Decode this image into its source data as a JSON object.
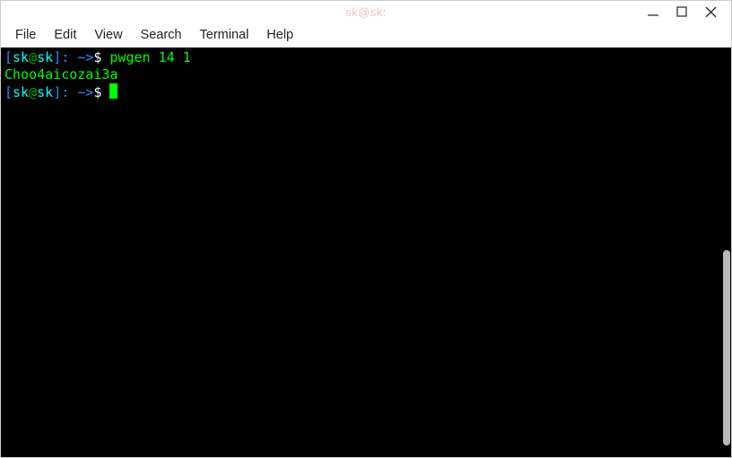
{
  "window": {
    "title": "sk@sk:"
  },
  "menu": {
    "file": "File",
    "edit": "Edit",
    "view": "View",
    "search": "Search",
    "terminal": "Terminal",
    "help": "Help"
  },
  "term": {
    "p1_open": "[",
    "p1_user": "sk",
    "p1_at": "@",
    "p1_host": "sk",
    "p1_close": "]: ",
    "p1_path": "~>",
    "p1_dollar": "$ ",
    "p1_cmd": "pwgen 14 1",
    "output1": "Choo4aicozai3a",
    "p2_open": "[",
    "p2_user": "sk",
    "p2_at": "@",
    "p2_host": "sk",
    "p2_close": "]: ",
    "p2_path": "~>",
    "p2_dollar": "$ "
  }
}
